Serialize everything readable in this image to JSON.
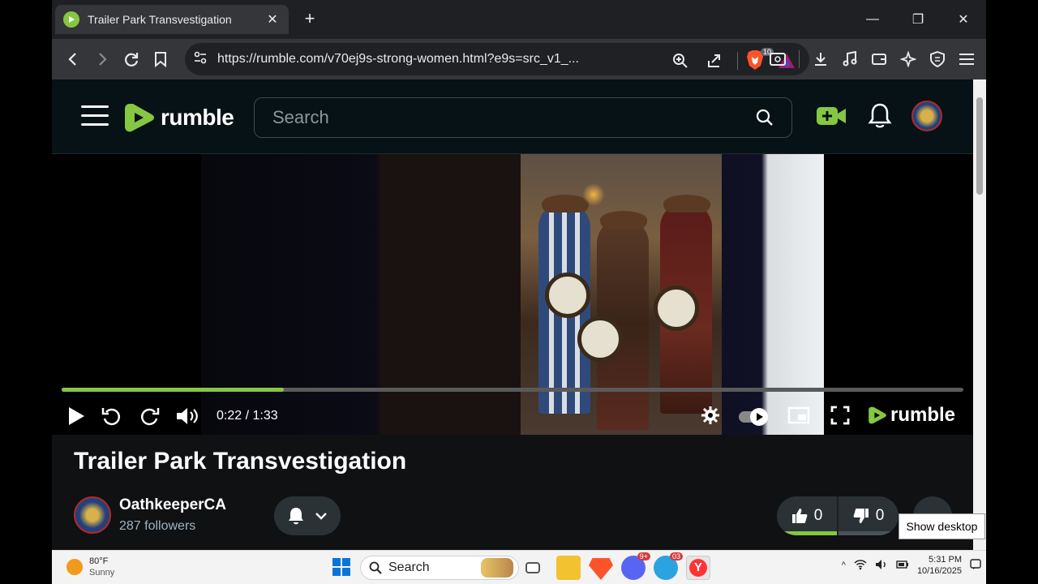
{
  "browser": {
    "tab_title": "Trailer Park Transvestigation",
    "url": "https://rumble.com/v70ej9s-strong-women.html?e9s=src_v1_...",
    "brave_shield_count": "10"
  },
  "site": {
    "logo_text": "rumble",
    "search_placeholder": "Search"
  },
  "player": {
    "time": "0:22 / 1:33",
    "progress": 0.246,
    "brand": "rumble"
  },
  "video": {
    "title": "Trailer Park Transvestigation",
    "channel_name": "OathkeeperCA",
    "followers": "287 followers",
    "likes": "0",
    "dislikes": "0"
  },
  "tooltip": "Show desktop",
  "taskbar": {
    "weather_temp": "80°F",
    "weather_desc": "Sunny",
    "search_label": "Search",
    "time": "5:31 PM",
    "date": "10/16/2025",
    "discord_badge": "9+",
    "telegram_badge": "03"
  },
  "colors": {
    "rumble_green": "#85c742",
    "page_bg": "#061215"
  }
}
